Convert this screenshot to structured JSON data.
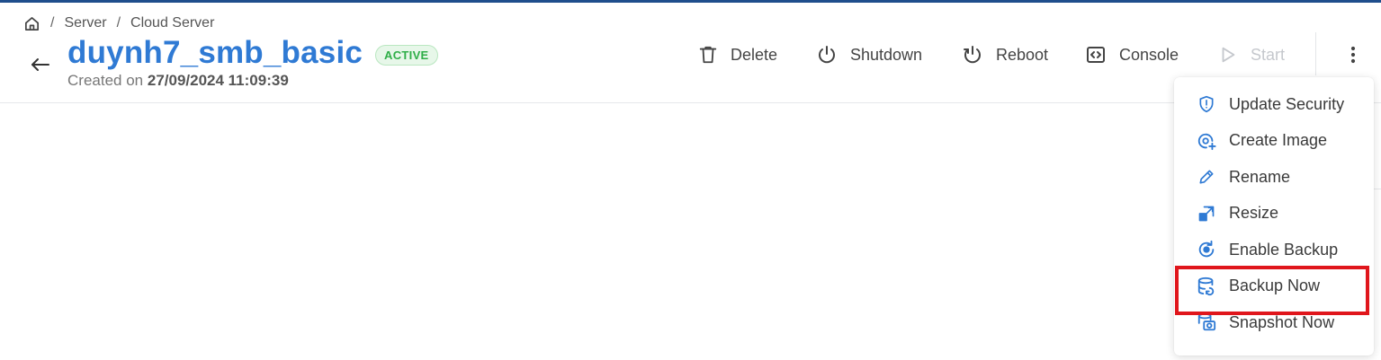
{
  "breadcrumb": {
    "items": [
      "Server",
      "Cloud Server"
    ],
    "separator": "/"
  },
  "server": {
    "name": "duynh7_smb_basic",
    "status": "ACTIVE",
    "created_label": "Created on",
    "created_at": "27/09/2024 11:09:39"
  },
  "toolbar": {
    "delete_label": "Delete",
    "shutdown_label": "Shutdown",
    "reboot_label": "Reboot",
    "console_label": "Console",
    "start_label": "Start"
  },
  "menu": {
    "items": [
      {
        "label": "Update Security",
        "icon": "shield-icon"
      },
      {
        "label": "Create Image",
        "icon": "disc-plus-icon"
      },
      {
        "label": "Rename",
        "icon": "pencil-icon"
      },
      {
        "label": "Resize",
        "icon": "resize-icon"
      },
      {
        "label": "Enable Backup",
        "icon": "backup-cycle-icon"
      },
      {
        "label": "Backup Now",
        "icon": "database-backup-icon"
      },
      {
        "label": "Snapshot Now",
        "icon": "camera-database-icon"
      }
    ]
  },
  "colors": {
    "accent": "#2f7ad4",
    "status_active": "#2fae48",
    "highlight": "#e0161c",
    "top_border": "#1f4e8c"
  }
}
